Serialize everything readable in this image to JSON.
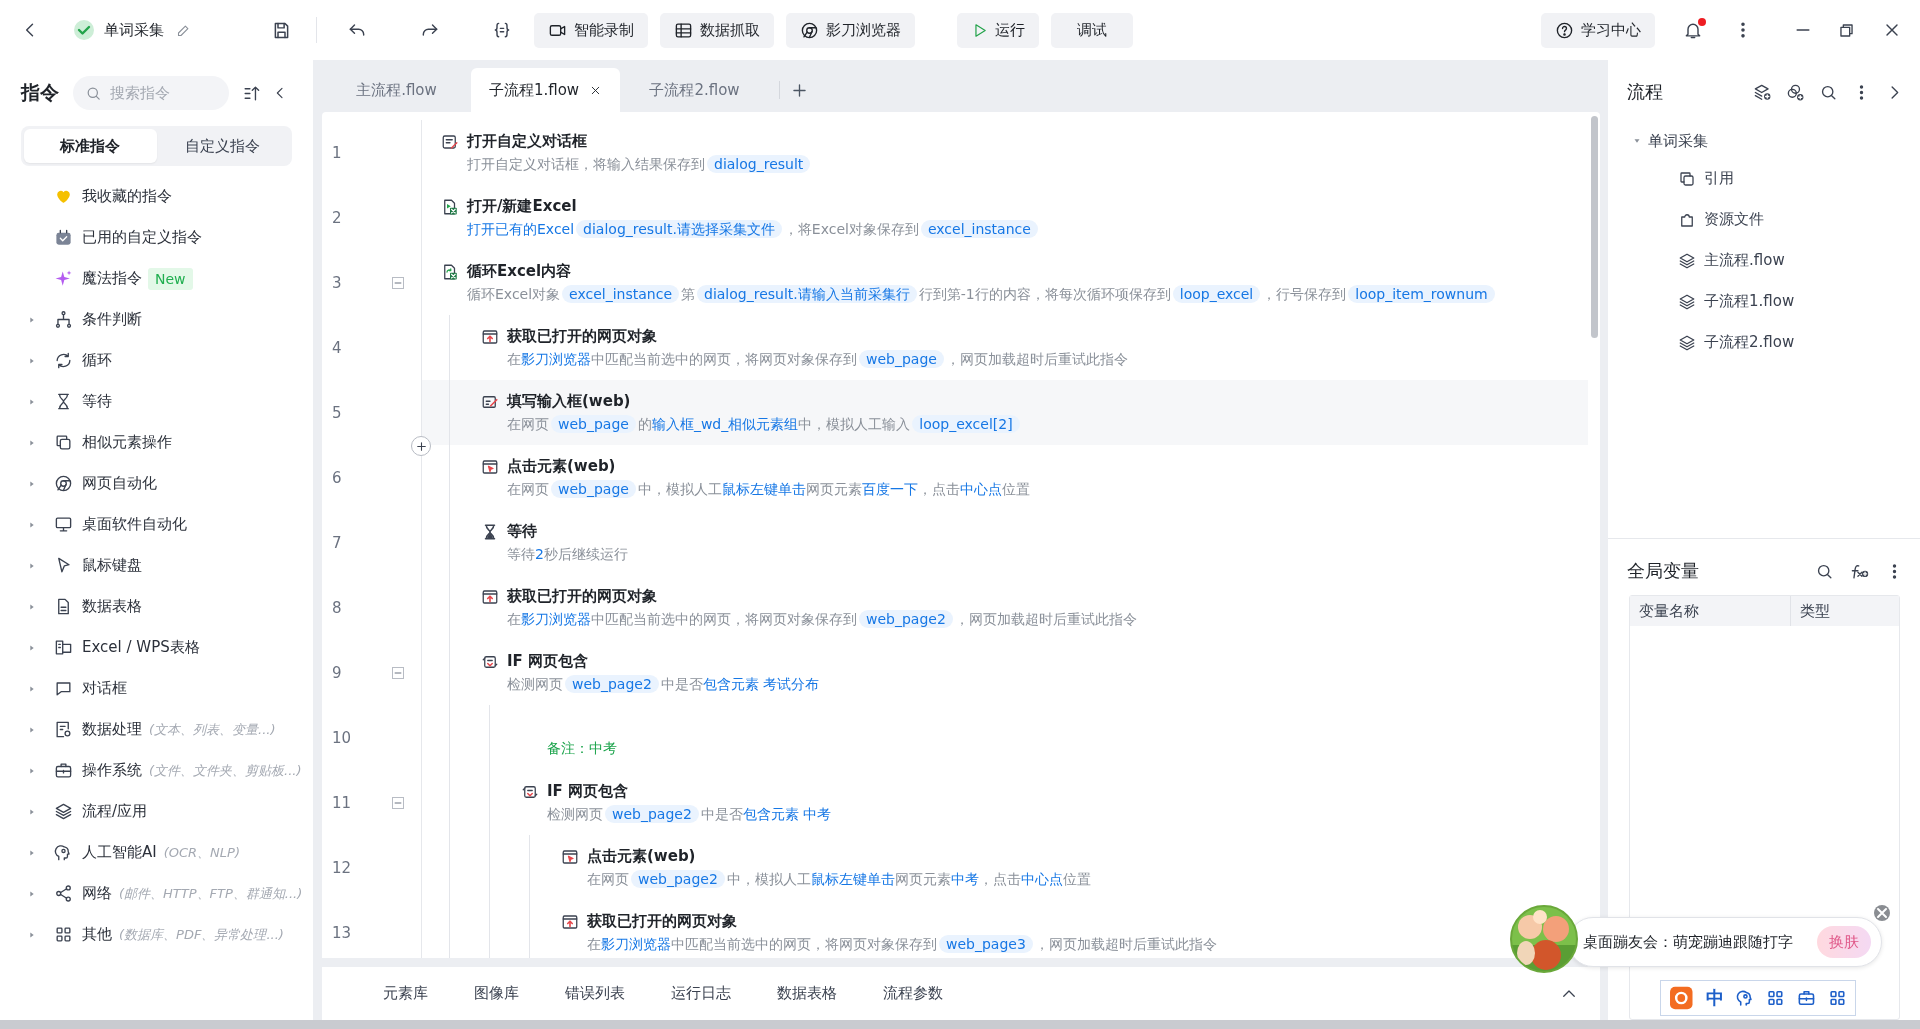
{
  "topbar": {
    "title": "单词采集",
    "actions": [
      {
        "label": "智能录制"
      },
      {
        "label": "数据抓取"
      },
      {
        "label": "影刀浏览器"
      }
    ],
    "run": "运行",
    "debug": "调试",
    "help": "学习中心",
    "has_unread": true
  },
  "sidebar": {
    "title": "指令",
    "search": {
      "placeholder": "搜索指令"
    },
    "tabs": [
      {
        "label": "标准指令",
        "selected": true
      },
      {
        "label": "自定义指令",
        "selected": false
      }
    ],
    "items": [
      {
        "label": "我收藏的指令"
      },
      {
        "label": "已用的自定义指令"
      },
      {
        "label": "魔法指令",
        "badge": "New"
      },
      {
        "label": "条件判断",
        "expanded": false
      },
      {
        "label": "循环",
        "expanded": false
      },
      {
        "label": "等待",
        "expanded": false
      },
      {
        "label": "相似元素操作",
        "expanded": false
      },
      {
        "label": "网页自动化",
        "expanded": false
      },
      {
        "label": "桌面软件自动化",
        "expanded": false
      },
      {
        "label": "鼠标键盘",
        "expanded": false
      },
      {
        "label": "数据表格",
        "expanded": false
      },
      {
        "label": "Excel / WPS表格",
        "expanded": false
      },
      {
        "label": "对话框",
        "expanded": false
      },
      {
        "label": "数据处理",
        "hint": "(文本、列表、变量...)",
        "expanded": false
      },
      {
        "label": "操作系统",
        "hint": "(文件、文件夹、剪贴板...)",
        "expanded": false
      },
      {
        "label": "流程/应用",
        "expanded": false
      },
      {
        "label": "人工智能AI",
        "hint": "(OCR、NLP)",
        "expanded": false
      },
      {
        "label": "网络",
        "hint": "(邮件、HTTP、FTP、群通知...)",
        "expanded": false
      },
      {
        "label": "其他",
        "hint": "(数据库、PDF、异常处理...)",
        "expanded": false
      }
    ]
  },
  "editor": {
    "tabs": [
      {
        "label": "主流程.flow",
        "selected": false
      },
      {
        "label": "子流程1.flow",
        "selected": true
      },
      {
        "label": "子流程2.flow",
        "selected": false
      }
    ],
    "steps": [
      {
        "line": "1",
        "kind": "step",
        "title": "打开自定义对话框",
        "selected": false,
        "parts": [
          {
            "kind": "text",
            "text": "打开自定义对话框，将输入结果保存到"
          },
          {
            "kind": "var",
            "text": "dialog_result"
          }
        ]
      },
      {
        "line": "2",
        "kind": "step",
        "title": "打开/新建Excel",
        "selected": false,
        "parts": [
          {
            "kind": "link",
            "text": "打开已有的Excel"
          },
          {
            "kind": "var",
            "text": "dialog_result.请选择采集文件"
          },
          {
            "kind": "text",
            "text": "，将Excel对象保存到"
          },
          {
            "kind": "var",
            "text": "excel_instance"
          }
        ]
      },
      {
        "line": "3",
        "kind": "step",
        "title": "循环Excel内容",
        "selected": false,
        "expanded": true,
        "parts": [
          {
            "kind": "text",
            "text": "循环Excel对象"
          },
          {
            "kind": "var",
            "text": "excel_instance"
          },
          {
            "kind": "text",
            "text": "第"
          },
          {
            "kind": "var",
            "text": "dialog_result.请输入当前采集行"
          },
          {
            "kind": "text",
            "text": "行到第-1行的内容，将每次循环项保存到"
          },
          {
            "kind": "var",
            "text": "loop_excel"
          },
          {
            "kind": "text",
            "text": "，行号保存到"
          },
          {
            "kind": "var",
            "text": "loop_item_rownum"
          }
        ],
        "children": [
          {
            "line": "4",
            "kind": "step",
            "title": "获取已打开的网页对象",
            "selected": false,
            "parts": [
              {
                "kind": "text",
                "text": "在"
              },
              {
                "kind": "link",
                "text": "影刀浏览器"
              },
              {
                "kind": "text",
                "text": "中匹配当前选中的网页，将网页对象保存到"
              },
              {
                "kind": "var",
                "text": "web_page"
              },
              {
                "kind": "text",
                "text": "，网页加载超时后重试此指令"
              }
            ]
          },
          {
            "line": "5",
            "kind": "step",
            "title": "填写输入框(web)",
            "selected": true,
            "parts": [
              {
                "kind": "text",
                "text": "在网页"
              },
              {
                "kind": "var",
                "text": "web_page"
              },
              {
                "kind": "text",
                "text": "的"
              },
              {
                "kind": "link",
                "text": "输入框_wd_相似元素组"
              },
              {
                "kind": "text",
                "text": "中，模拟人工输入"
              },
              {
                "kind": "var",
                "text": "loop_excel[2]"
              }
            ]
          },
          {
            "line": "6",
            "kind": "step",
            "title": "点击元素(web)",
            "selected": false,
            "parts": [
              {
                "kind": "text",
                "text": "在网页"
              },
              {
                "kind": "var",
                "text": "web_page"
              },
              {
                "kind": "text",
                "text": "中，模拟人工"
              },
              {
                "kind": "link",
                "text": "鼠标左键单击"
              },
              {
                "kind": "text",
                "text": "网页元素"
              },
              {
                "kind": "link",
                "text": "百度一下"
              },
              {
                "kind": "text",
                "text": "，点击"
              },
              {
                "kind": "link",
                "text": "中心点"
              },
              {
                "kind": "text",
                "text": "位置"
              }
            ]
          },
          {
            "line": "7",
            "kind": "step",
            "title": "等待",
            "selected": false,
            "parts": [
              {
                "kind": "text",
                "text": "等待"
              },
              {
                "kind": "link",
                "text": "2"
              },
              {
                "kind": "text",
                "text": "秒后继续运行"
              }
            ]
          },
          {
            "line": "8",
            "kind": "step",
            "title": "获取已打开的网页对象",
            "selected": false,
            "parts": [
              {
                "kind": "text",
                "text": "在"
              },
              {
                "kind": "link",
                "text": "影刀浏览器"
              },
              {
                "kind": "text",
                "text": "中匹配当前选中的网页，将网页对象保存到"
              },
              {
                "kind": "var",
                "text": "web_page2"
              },
              {
                "kind": "text",
                "text": "，网页加载超时后重试此指令"
              }
            ]
          },
          {
            "line": "9",
            "kind": "step",
            "title": "IF 网页包含",
            "selected": false,
            "expanded": true,
            "parts": [
              {
                "kind": "text",
                "text": "检测网页"
              },
              {
                "kind": "var",
                "text": "web_page2"
              },
              {
                "kind": "text",
                "text": "中是否"
              },
              {
                "kind": "link",
                "text": "包含元素 考试分布"
              }
            ],
            "children": [
              {
                "line": "10",
                "kind": "comment",
                "title": "备注：中考",
                "selected": false
              },
              {
                "line": "11",
                "kind": "step",
                "title": "IF 网页包含",
                "selected": false,
                "expanded": true,
                "parts": [
                  {
                    "kind": "text",
                    "text": "检测网页"
                  },
                  {
                    "kind": "var",
                    "text": "web_page2"
                  },
                  {
                    "kind": "text",
                    "text": "中是否"
                  },
                  {
                    "kind": "link",
                    "text": "包含元素 中考"
                  }
                ],
                "children": [
                  {
                    "line": "12",
                    "kind": "step",
                    "title": "点击元素(web)",
                    "selected": false,
                    "parts": [
                      {
                        "kind": "text",
                        "text": "在网页"
                      },
                      {
                        "kind": "var",
                        "text": "web_page2"
                      },
                      {
                        "kind": "text",
                        "text": "中，模拟人工"
                      },
                      {
                        "kind": "link",
                        "text": "鼠标左键单击"
                      },
                      {
                        "kind": "text",
                        "text": "网页元素"
                      },
                      {
                        "kind": "link",
                        "text": "中考"
                      },
                      {
                        "kind": "text",
                        "text": "，点击"
                      },
                      {
                        "kind": "link",
                        "text": "中心点"
                      },
                      {
                        "kind": "text",
                        "text": "位置"
                      }
                    ]
                  },
                  {
                    "line": "13",
                    "kind": "step",
                    "title": "获取已打开的网页对象",
                    "selected": false,
                    "parts": [
                      {
                        "kind": "text",
                        "text": "在"
                      },
                      {
                        "kind": "link",
                        "text": "影刀浏览器"
                      },
                      {
                        "kind": "text",
                        "text": "中匹配当前选中的网页，将网页对象保存到"
                      },
                      {
                        "kind": "var",
                        "text": "web_page3"
                      },
                      {
                        "kind": "text",
                        "text": "，网页加载超时后重试此指令"
                      }
                    ]
                  }
                ]
              }
            ]
          }
        ]
      }
    ]
  },
  "bottom_tabs": [
    {
      "label": "元素库"
    },
    {
      "label": "图像库"
    },
    {
      "label": "错误列表"
    },
    {
      "label": "运行日志"
    },
    {
      "label": "数据表格"
    },
    {
      "label": "流程参数"
    }
  ],
  "flow_panel": {
    "title": "流程",
    "tree": [
      {
        "label": "单词采集",
        "expanded": true,
        "children": [
          {
            "label": "引用"
          },
          {
            "label": "资源文件"
          },
          {
            "label": "主流程.flow"
          },
          {
            "label": "子流程1.flow"
          },
          {
            "label": "子流程2.flow"
          }
        ]
      }
    ]
  },
  "variables_panel": {
    "title": "全局变量",
    "columns": [
      "变量名称",
      "类型"
    ]
  },
  "popup": {
    "text": "桌面蹦友会：萌宠蹦迪跟随打字",
    "button": "换肤"
  },
  "ime_bar": {
    "mode": "中"
  }
}
